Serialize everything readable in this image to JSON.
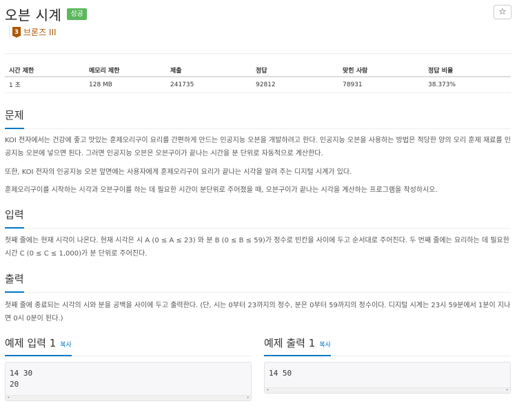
{
  "problem": {
    "title": "오븐 시계",
    "status_badge": "성공",
    "star_icon": "☆",
    "tier_number": "3",
    "tier_label": "브론즈 III"
  },
  "info_table": {
    "headers": [
      "시간 제한",
      "메모리 제한",
      "제출",
      "정답",
      "맞힌 사람",
      "정답 비율"
    ],
    "values": [
      "1 초",
      "128 MB",
      "241735",
      "92812",
      "78931",
      "38.373%"
    ]
  },
  "sections": {
    "problem": {
      "heading": "문제",
      "paragraphs": [
        "KOI 전자에서는 건강에 좋고 맛있는 훈제오리구이 요리를 간편하게 만드는 인공지능 오븐을 개발하려고 한다. 인공지능 오븐을 사용하는 방법은 적당한 양의 오리 훈제 재료를 인공지능 오븐에 넣으면 된다. 그러면 인공지능 오븐은 오븐구이가 끝나는 시간을 분 단위로 자동적으로 계산한다.",
        "또한, KOI 전자의 인공지능 오븐 앞면에는 사용자에게 훈제오리구이 요리가 끝나는 시각을 알려 주는 디지털 시계가 있다.",
        "훈제오리구이를 시작하는 시각과 오븐구이를 하는 데 필요한 시간이 분단위로 주어졌을 때, 오븐구이가 끝나는 시각을 계산하는 프로그램을 작성하시오."
      ]
    },
    "input": {
      "heading": "입력",
      "paragraph": "첫째 줄에는 현재 시각이 나온다. 현재 시각은 시 A (0 ≤ A ≤ 23) 와 분 B (0 ≤ B ≤ 59)가 정수로 빈칸을 사이에 두고 순서대로 주어진다. 두 번째 줄에는 요리하는 데 필요한 시간 C (0 ≤ C ≤ 1,000)가 분 단위로 주어진다."
    },
    "output": {
      "heading": "출력",
      "paragraph": "첫째 줄에 종료되는 시각의 시와 분을 공백을 사이에 두고 출력한다. (단, 시는 0부터 23까지의 정수, 분은 0부터 59까지의 정수이다. 디지털 시계는 23시 59분에서 1분이 지나면 0시 0분이 된다.)"
    }
  },
  "samples": {
    "input": {
      "heading": "예제 입력 1",
      "copy_label": "복사",
      "lines": [
        "14 30",
        "20"
      ]
    },
    "output": {
      "heading": "예제 출력 1",
      "copy_label": "복사",
      "lines": [
        "14 50"
      ]
    }
  },
  "colors": {
    "success": "#5cb85c",
    "bronze": "#ad5600",
    "link": "#0076c0"
  }
}
